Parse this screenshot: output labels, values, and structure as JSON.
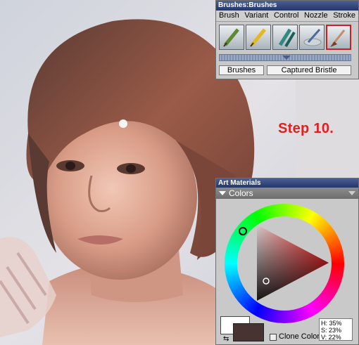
{
  "step_label": "Step 10.",
  "brushes_panel": {
    "title": "Brushes:Brushes",
    "menu": [
      "Brush",
      "Variant",
      "Control",
      "Nozzle",
      "Stroke"
    ],
    "brush_category": "Brushes",
    "brush_variant": "Captured Bristle",
    "icons": [
      "pencil-brush-icon",
      "pen-brush-icon",
      "marker-brush-icon",
      "water-brush-icon",
      "captured-bristle-icon"
    ]
  },
  "art_materials": {
    "title": "Art Materials",
    "section": "Colors",
    "clone_color_label": "Clone Color",
    "hsv": {
      "h": "H: 35%",
      "s": "S: 23%",
      "v": "V: 22%"
    },
    "main_color": "#463332",
    "secondary_color": "#ffffff"
  }
}
